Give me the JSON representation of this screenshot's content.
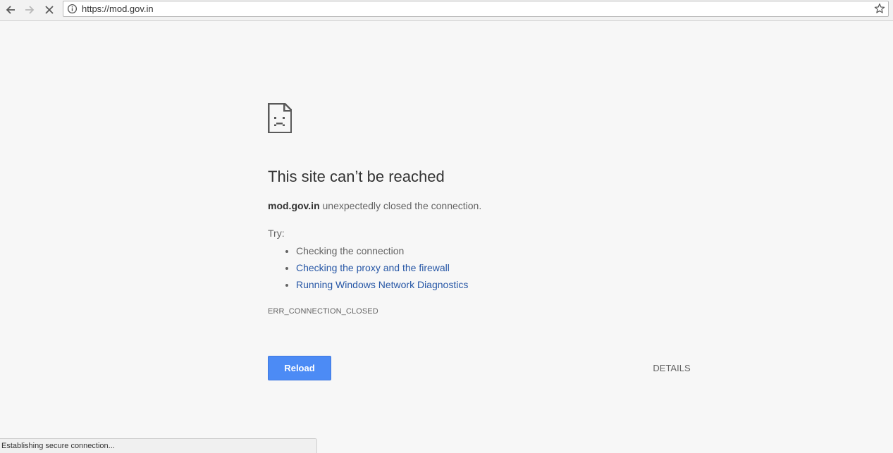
{
  "browser": {
    "url": "https://mod.gov.in",
    "icons": {
      "back": "arrow-left-icon",
      "forward": "arrow-right-icon",
      "stop": "close-icon",
      "info": "info-icon",
      "bookmark": "star-icon"
    }
  },
  "error_page": {
    "icon": "sad-page-icon",
    "title": "This site can’t be reached",
    "summary_host": "mod.gov.in",
    "summary_text": " unexpectedly closed the connection.",
    "try_label": "Try:",
    "suggestions": [
      {
        "label": "Checking the connection",
        "is_link": false
      },
      {
        "label": "Checking the proxy and the firewall",
        "is_link": true
      },
      {
        "label": "Running Windows Network Diagnostics",
        "is_link": true
      }
    ],
    "error_code": "ERR_CONNECTION_CLOSED",
    "reload_label": "Reload",
    "details_label": "DETAILS"
  },
  "status_bar": {
    "text": "Establishing secure connection..."
  },
  "colors": {
    "accent_button": "#4c8bf5",
    "link": "#2757a6",
    "page_background": "#f7f7f7"
  }
}
